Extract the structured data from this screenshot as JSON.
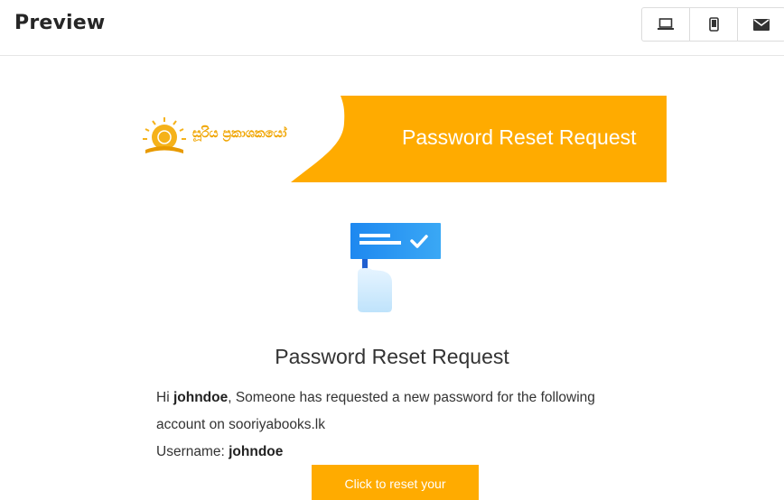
{
  "header": {
    "title": "Preview",
    "view_buttons": [
      {
        "name": "desktop-view",
        "icon": "laptop-icon"
      },
      {
        "name": "mobile-view",
        "icon": "mobile-icon"
      },
      {
        "name": "email-view",
        "icon": "mail-icon"
      }
    ]
  },
  "email": {
    "logo_text": "සූරිය ප්‍රකාශකයෝ",
    "banner_title": "Password Reset Request",
    "heading": "Password Reset Request",
    "greeting_prefix": "Hi ",
    "username_inline": "johndoe",
    "message": ", Someone has requested a new password for the following account on sooriyabooks.lk",
    "username_label": "Username: ",
    "username_value": "johndoe",
    "button_label": "Click to reset your"
  },
  "colors": {
    "accent": "#ffab00",
    "text": "#333333",
    "icon_blue": "#2b8cf0"
  }
}
